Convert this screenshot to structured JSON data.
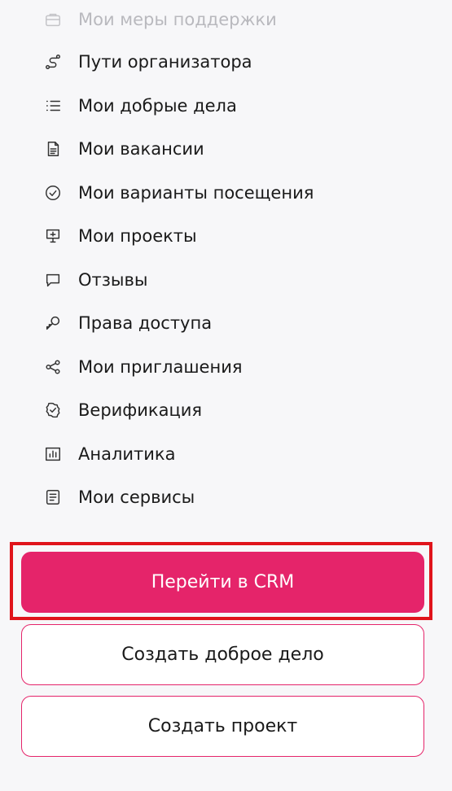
{
  "menu": {
    "items": [
      {
        "label": "Мои меры поддержки",
        "icon": "briefcase-icon",
        "faded": true
      },
      {
        "label": "Пути организатора",
        "icon": "route-icon"
      },
      {
        "label": "Мои добрые дела",
        "icon": "list-icon"
      },
      {
        "label": "Мои вакансии",
        "icon": "document-icon"
      },
      {
        "label": "Мои варианты посещения",
        "icon": "check-circle-icon"
      },
      {
        "label": "Мои проекты",
        "icon": "presentation-icon"
      },
      {
        "label": "Отзывы",
        "icon": "chat-icon"
      },
      {
        "label": "Права доступа",
        "icon": "key-icon"
      },
      {
        "label": "Мои приглашения",
        "icon": "share-icon"
      },
      {
        "label": "Верификация",
        "icon": "verified-badge-icon"
      },
      {
        "label": "Аналитика",
        "icon": "bar-chart-icon"
      },
      {
        "label": "Мои сервисы",
        "icon": "services-icon"
      }
    ]
  },
  "actions": {
    "crm_label": "Перейти в CRM",
    "create_deed_label": "Создать доброе дело",
    "create_project_label": "Создать проект"
  },
  "colors": {
    "accent": "#e5246a",
    "highlight_frame": "#e0141b",
    "background": "#f7f7f9"
  }
}
